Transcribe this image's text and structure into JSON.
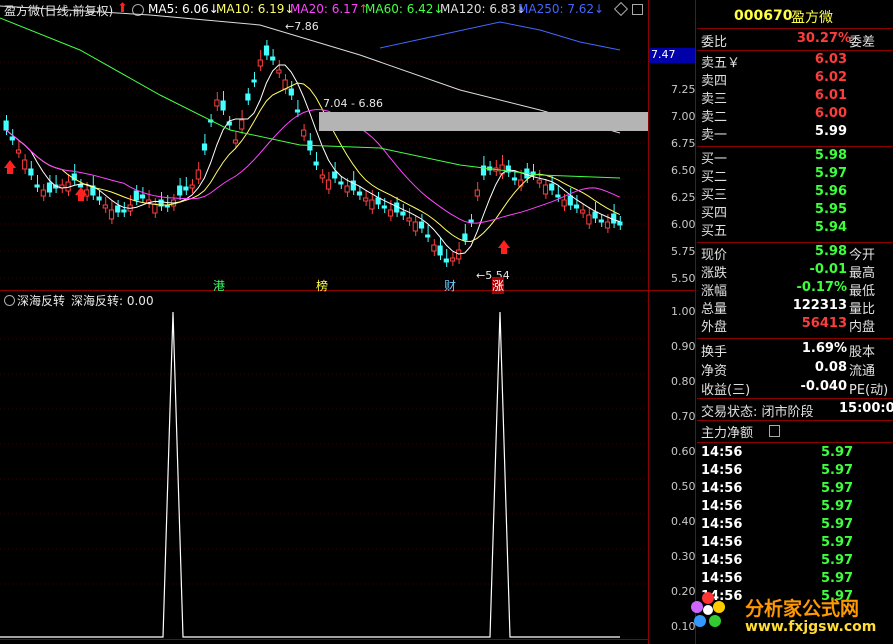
{
  "top_chart": {
    "title": "盈方微(日线,前复权)",
    "ma": [
      {
        "label": "MA5: 6.06",
        "color": "#ffffff",
        "arrow": "↓"
      },
      {
        "label": "MA10: 6.19",
        "color": "#ffff66",
        "arrow": "↓"
      },
      {
        "label": "MA20: 6.17",
        "color": "#ff44ff",
        "arrow": "↑"
      },
      {
        "label": "MA60: 6.42",
        "color": "#44ff44",
        "arrow": "↓"
      },
      {
        "label": "MA120: 6.83",
        "color": "#dddddd",
        "arrow": "↓"
      },
      {
        "label": "MA250: 7.62",
        "color": "#4466ff",
        "arrow": "↓"
      }
    ],
    "price_current_tag": "7.47",
    "y_ticks": [
      "7.25",
      "7.00",
      "6.75",
      "6.50",
      "6.25",
      "6.00",
      "5.75",
      "5.50"
    ],
    "annotations": {
      "high": "←7.86",
      "low": "←5.54",
      "gap": "7.04 - 6.86"
    },
    "markers": [
      "港",
      "榜",
      "财",
      "涨"
    ]
  },
  "indicator": {
    "title": "深海反转",
    "value_label": "深海反转: 0.00",
    "y_ticks": [
      "1.00",
      "0.90",
      "0.80",
      "0.70",
      "0.60",
      "0.50",
      "0.40",
      "0.30",
      "0.20",
      "0.10"
    ]
  },
  "quote": {
    "code": "000670",
    "name": "盈方微",
    "weibi_label": "委比",
    "weibi_value": "30.27%",
    "weicha_label": "委差",
    "sell": [
      {
        "label": "卖五￥",
        "price": "6.03"
      },
      {
        "label": "卖四",
        "price": "6.02"
      },
      {
        "label": "卖三",
        "price": "6.01"
      },
      {
        "label": "卖二",
        "price": "6.00"
      },
      {
        "label": "卖一",
        "price": "5.99"
      }
    ],
    "buy": [
      {
        "label": "买一",
        "price": "5.98"
      },
      {
        "label": "买二",
        "price": "5.97"
      },
      {
        "label": "买三",
        "price": "5.96"
      },
      {
        "label": "买四",
        "price": "5.95"
      },
      {
        "label": "买五",
        "price": "5.94"
      }
    ],
    "stats": [
      {
        "label": "现价",
        "value": "5.98",
        "label2": "今开",
        "cls": "green"
      },
      {
        "label": "涨跌",
        "value": "-0.01",
        "label2": "最高",
        "cls": "green"
      },
      {
        "label": "涨幅",
        "value": "-0.17%",
        "label2": "最低",
        "cls": "green"
      },
      {
        "label": "总量",
        "value": "122313",
        "label2": "量比",
        "cls": "white"
      },
      {
        "label": "外盘",
        "value": "56413",
        "label2": "内盘",
        "cls": "red"
      }
    ],
    "stats2": [
      {
        "label": "换手",
        "value": "1.69%",
        "label2": "股本"
      },
      {
        "label": "净资",
        "value": "0.08",
        "label2": "流通"
      },
      {
        "label": "收益(三)",
        "value": "-0.040",
        "label2": "PE(动)"
      }
    ],
    "trade_status": "交易状态: 闭市阶段",
    "trade_time": "15:00:00",
    "main_net": "主力净额",
    "ticks": [
      {
        "time": "14:56",
        "price": "5.97"
      },
      {
        "time": "14:56",
        "price": "5.97"
      },
      {
        "time": "14:56",
        "price": "5.97"
      },
      {
        "time": "14:56",
        "price": "5.97"
      },
      {
        "time": "14:56",
        "price": "5.97"
      },
      {
        "time": "14:56",
        "price": "5.97"
      },
      {
        "time": "14:56",
        "price": "5.97"
      },
      {
        "time": "14:56",
        "price": "5.97"
      },
      {
        "time": "14:56",
        "price": "5.97"
      }
    ]
  },
  "watermark": {
    "cn": "分析家公式网",
    "url": "www.fxjgsw.com"
  }
}
